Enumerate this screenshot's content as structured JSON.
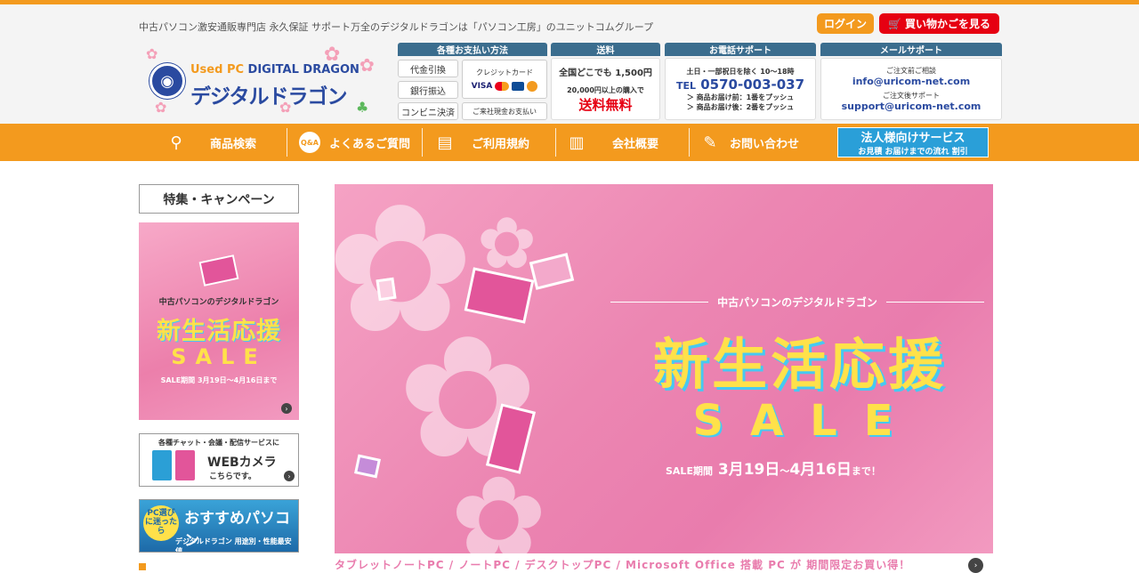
{
  "header": {
    "tagline": "中古パソコン激安通販専門店 永久保証 サポート万全のデジタルドラゴンは「パソコン工房」のユニットコムグループ",
    "login_label": "ログイン",
    "cart_label": "買い物かごを見る",
    "logo_en_prefix": "Used PC",
    "logo_en_name": "DIGITAL DRAGON",
    "logo_jp": "デジタルドラゴン"
  },
  "info": {
    "payment": {
      "title": "各種お支払い方法",
      "cod": "代金引換",
      "bank": "銀行振込",
      "convenience": "コンビニ決済",
      "credit": "クレジットカード",
      "cards": [
        "VISA",
        "MC",
        "JCB",
        "Orico"
      ],
      "store_cash": "ご来社現金お支払い"
    },
    "shipping": {
      "title": "送料",
      "line1": "全国どこでも 1,500円",
      "line2": "20,000円以上の購入で",
      "line3": "送料無料"
    },
    "phone": {
      "title": "お電話サポート",
      "hours": "土日・一部祝日を除く 10～18時",
      "tel_prefix": "TEL",
      "tel": "0570-003-037",
      "before": "＞ 商品お届け前：1番をプッシュ",
      "after": "＞ 商品お届け後：2番をプッシュ"
    },
    "mail": {
      "title": "メールサポート",
      "before_label": "ご注文前ご相談",
      "before_email": "info@uricom-net.com",
      "after_label": "ご注文後サポート",
      "after_email": "support@uricom-net.com"
    }
  },
  "nav": {
    "search": "商品検索",
    "faq": "よくあるご質問",
    "faq_icon_text": "Q&A",
    "terms": "ご利用規約",
    "company": "会社概要",
    "contact": "お問い合わせ",
    "corp_title": "法人様向けサービス",
    "corp_sub": "お見積 お届けまでの流れ 割引"
  },
  "sidebar": {
    "title": "特集・キャンペーン",
    "sale_banner": {
      "brand": "中古パソコンのデジタルドラゴン",
      "main": "新生活応援",
      "sale": "SALE",
      "period": "SALE期間 3月19日～4月16日まで"
    },
    "webcam_banner": {
      "line1": "各種チャット・会議・配信サービスに",
      "line2": "WEBカメラ",
      "line3": "こちらです。"
    },
    "recommend_banner": {
      "badge": "PC選びに迷ったら",
      "title": "おすすめパソコン",
      "sub": "デジタルドラゴン 用途別・性能最安値"
    }
  },
  "hero": {
    "brand": "中古パソコンのデジタルドラゴン",
    "main": "新生活応援",
    "sale": "SALE",
    "period_label": "SALE期間",
    "period_start": "3月19日",
    "period_sep": "～",
    "period_end": "4月16日",
    "period_tail": "まで！"
  },
  "ticker": {
    "text": "タブレットノートPC / ノートPC / デスクトップPC / Microsoft Office 搭載 PC が 期間限定お買い得！"
  },
  "colors": {
    "accent": "#f39a1e",
    "cart_red": "#e60012",
    "header_bar": "#3b6d8e",
    "corp_blue": "#2a9fd8",
    "hero_pink": "#ec86b2",
    "sale_yellow": "#ffe14a"
  }
}
